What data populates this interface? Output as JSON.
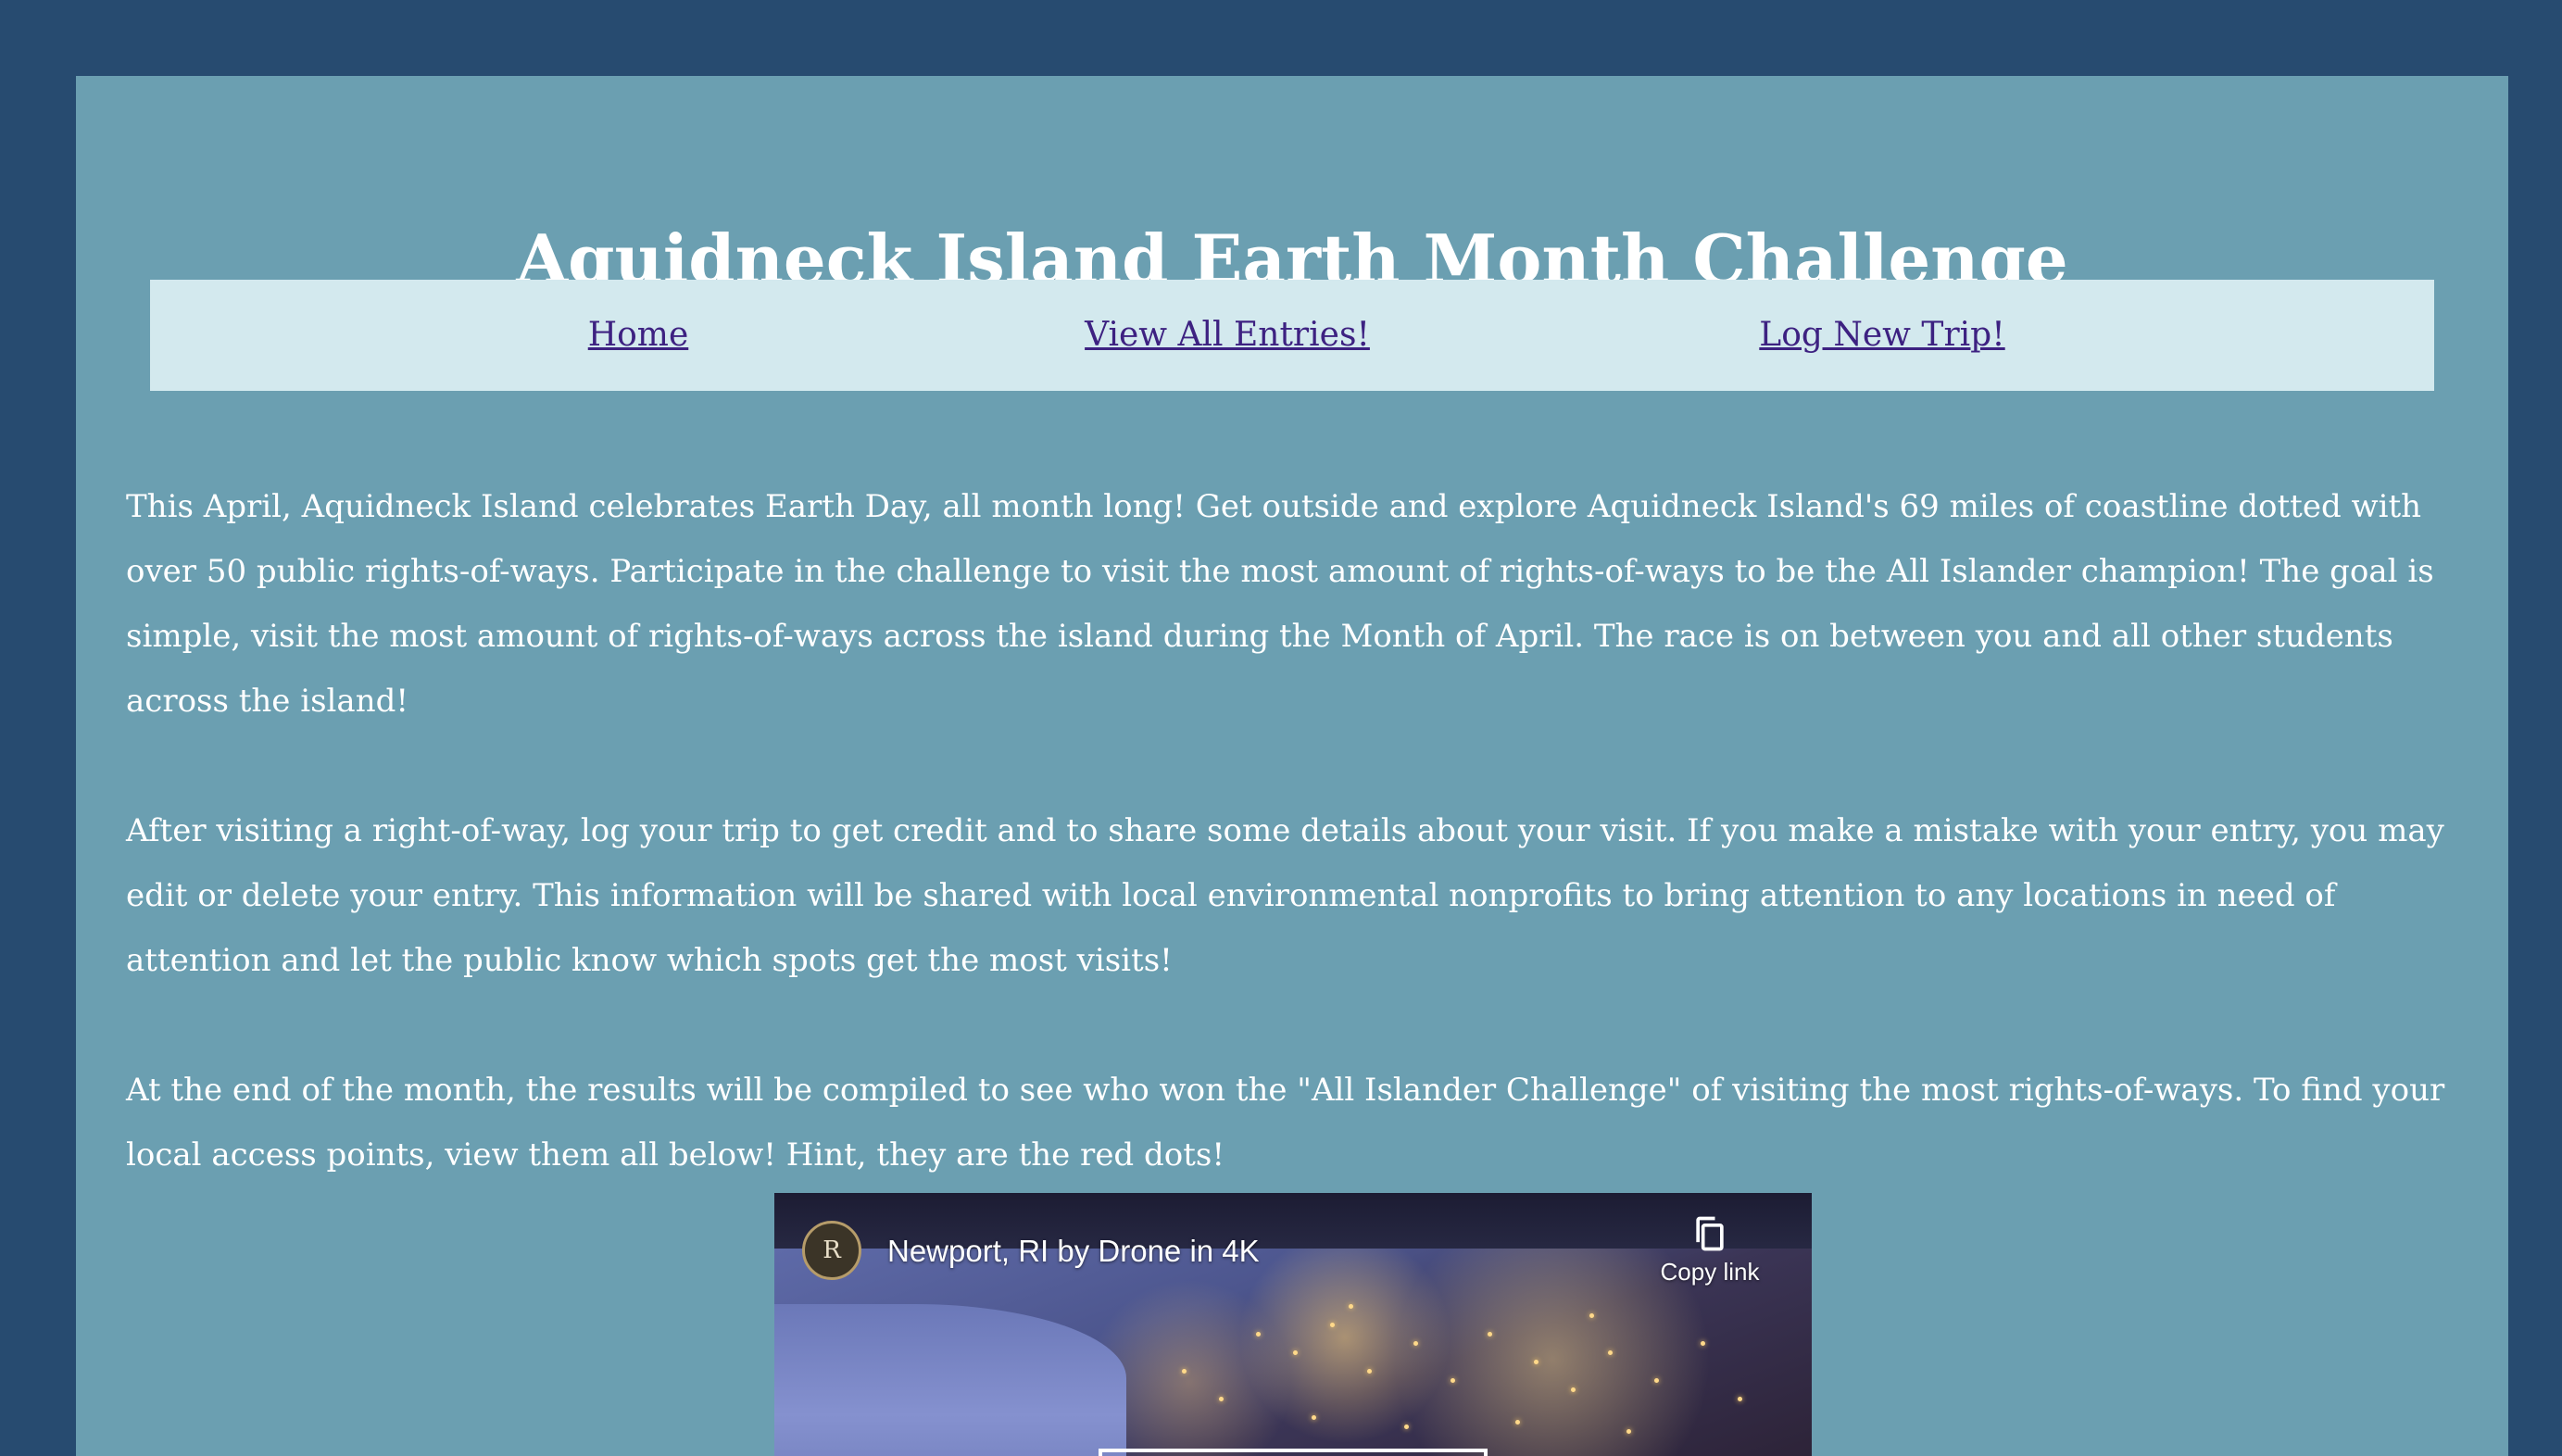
{
  "page": {
    "title": "Aquidneck Island Earth Month Challenge"
  },
  "nav": {
    "home": "Home",
    "view_entries": "View All Entries!",
    "log_trip": "Log New Trip!"
  },
  "intro": {
    "paragraphs": [
      "This April, Aquidneck Island celebrates Earth Day, all month long! Get outside and explore Aquidneck Island's 69 miles of coastline dotted with over 50 public rights-of-ways. Participate in the challenge to visit the most amount of rights-of-ways to be the All Islander champion! The goal is simple, visit the most amount of rights-of-ways across the island during the Month of April. The race is on between you and all other students across the island!",
      "After visiting a right-of-way, log your trip to get credit and to share some details about your visit. If you make a mistake with your entry, you may edit or delete your entry. This information will be shared with local environmental nonprofits to bring attention to any locations in need of attention and let the public know which spots get the most visits!",
      "At the end of the month, the results will be compiled to see who won the \"All Islander Challenge\" of visiting the most rights-of-ways. To find your local access points, view them all below! Hint, they are the red dots!"
    ]
  },
  "video": {
    "title": "Newport, RI by Drone in 4K",
    "copy_link_label": "Copy link",
    "channel_initial": "R",
    "copy_icon": "copy-icon"
  },
  "colors": {
    "page_background": "#274b70",
    "card_background": "#6b9fb1",
    "nav_background": "#d3e9ee",
    "nav_link": "#3d2181",
    "text": "#ffffff"
  }
}
